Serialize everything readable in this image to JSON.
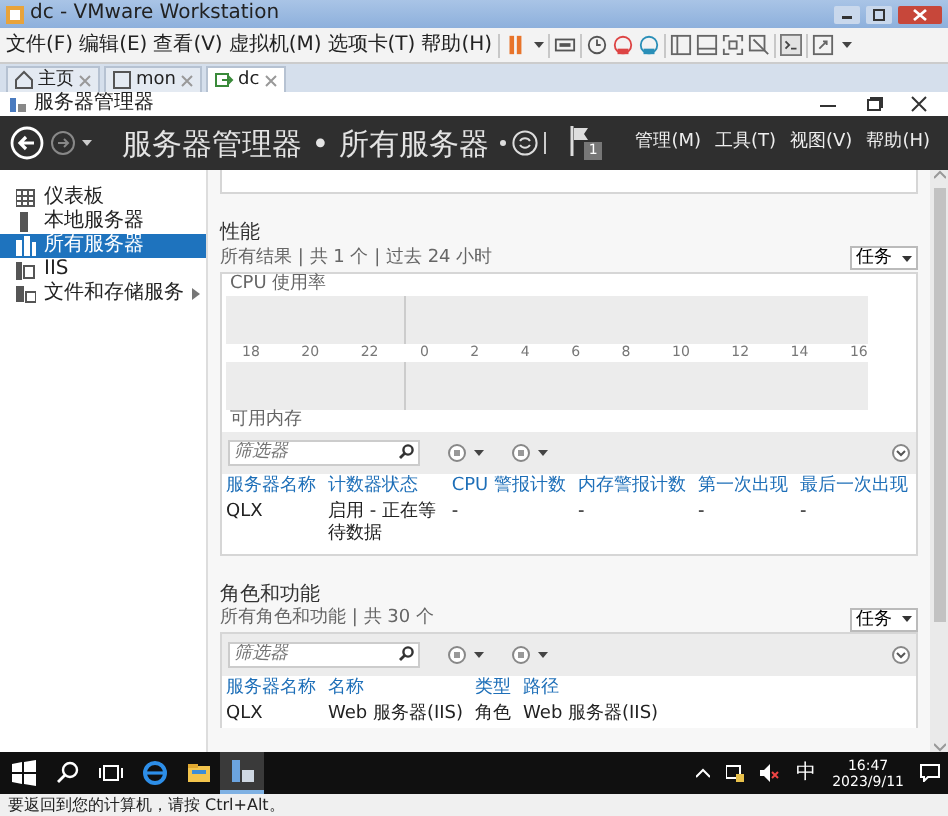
{
  "vm_window": {
    "title": "dc - VMware Workstation"
  },
  "vm_menu": [
    "文件(F)",
    "编辑(E)",
    "查看(V)",
    "虚拟机(M)",
    "选项卡(T)",
    "帮助(H)"
  ],
  "vm_tabs": [
    {
      "label": "主页",
      "kind": "home",
      "selected": false
    },
    {
      "label": "mon",
      "kind": "vm",
      "selected": false
    },
    {
      "label": "dc",
      "kind": "vm-running",
      "selected": true
    }
  ],
  "server_manager": {
    "title": "服务器管理器",
    "heading": "服务器管理器 • 所有服务器",
    "notification_count": "1",
    "menus": [
      "管理(M)",
      "工具(T)",
      "视图(V)",
      "帮助(H)"
    ]
  },
  "sidebar": [
    {
      "label": "仪表板",
      "kind": "dashboard",
      "selected": false,
      "expandable": false
    },
    {
      "label": "本地服务器",
      "kind": "local",
      "selected": false,
      "expandable": false
    },
    {
      "label": "所有服务器",
      "kind": "all",
      "selected": true,
      "expandable": false
    },
    {
      "label": "IIS",
      "kind": "iis",
      "selected": false,
      "expandable": false
    },
    {
      "label": "文件和存储服务",
      "kind": "storage",
      "selected": false,
      "expandable": true
    }
  ],
  "performance": {
    "title": "性能",
    "subtitle": "所有结果 | 共 1 个 | 过去 24 小时",
    "tasks_button": "任务",
    "cpu_label": "CPU 使用率",
    "time_axis": [
      "18",
      "20",
      "22",
      "0",
      "2",
      "4",
      "6",
      "8",
      "10",
      "12",
      "14",
      "16"
    ],
    "memory_label": "可用内存",
    "filter_placeholder": "筛选器",
    "columns": [
      "服务器名称",
      "计数器状态",
      "CPU 警报计数",
      "内存警报计数",
      "第一次出现",
      "最后一次出现"
    ],
    "rows": [
      [
        "QLX",
        "启用 - 正在等待数据",
        "-",
        "-",
        "-",
        "-"
      ]
    ]
  },
  "roles": {
    "title": "角色和功能",
    "subtitle": "所有角色和功能 | 共 30 个",
    "tasks_button": "任务",
    "filter_placeholder": "筛选器",
    "columns": [
      "服务器名称",
      "名称",
      "类型",
      "路径"
    ],
    "rows": [
      [
        "QLX",
        "Web 服务器(IIS)",
        "角色",
        "Web 服务器(IIS)"
      ]
    ]
  },
  "taskbar": {
    "apps": [
      {
        "kind": "start",
        "selected": false
      },
      {
        "kind": "search",
        "selected": false
      },
      {
        "kind": "task-view",
        "selected": false
      },
      {
        "kind": "browser",
        "selected": false
      },
      {
        "kind": "explorer",
        "selected": false
      },
      {
        "kind": "server-manager",
        "selected": true
      }
    ],
    "ime": "中",
    "time": "16:47",
    "date": "2023/9/11"
  },
  "status_bar": "要返回到您的计算机，请按 Ctrl+Alt。"
}
